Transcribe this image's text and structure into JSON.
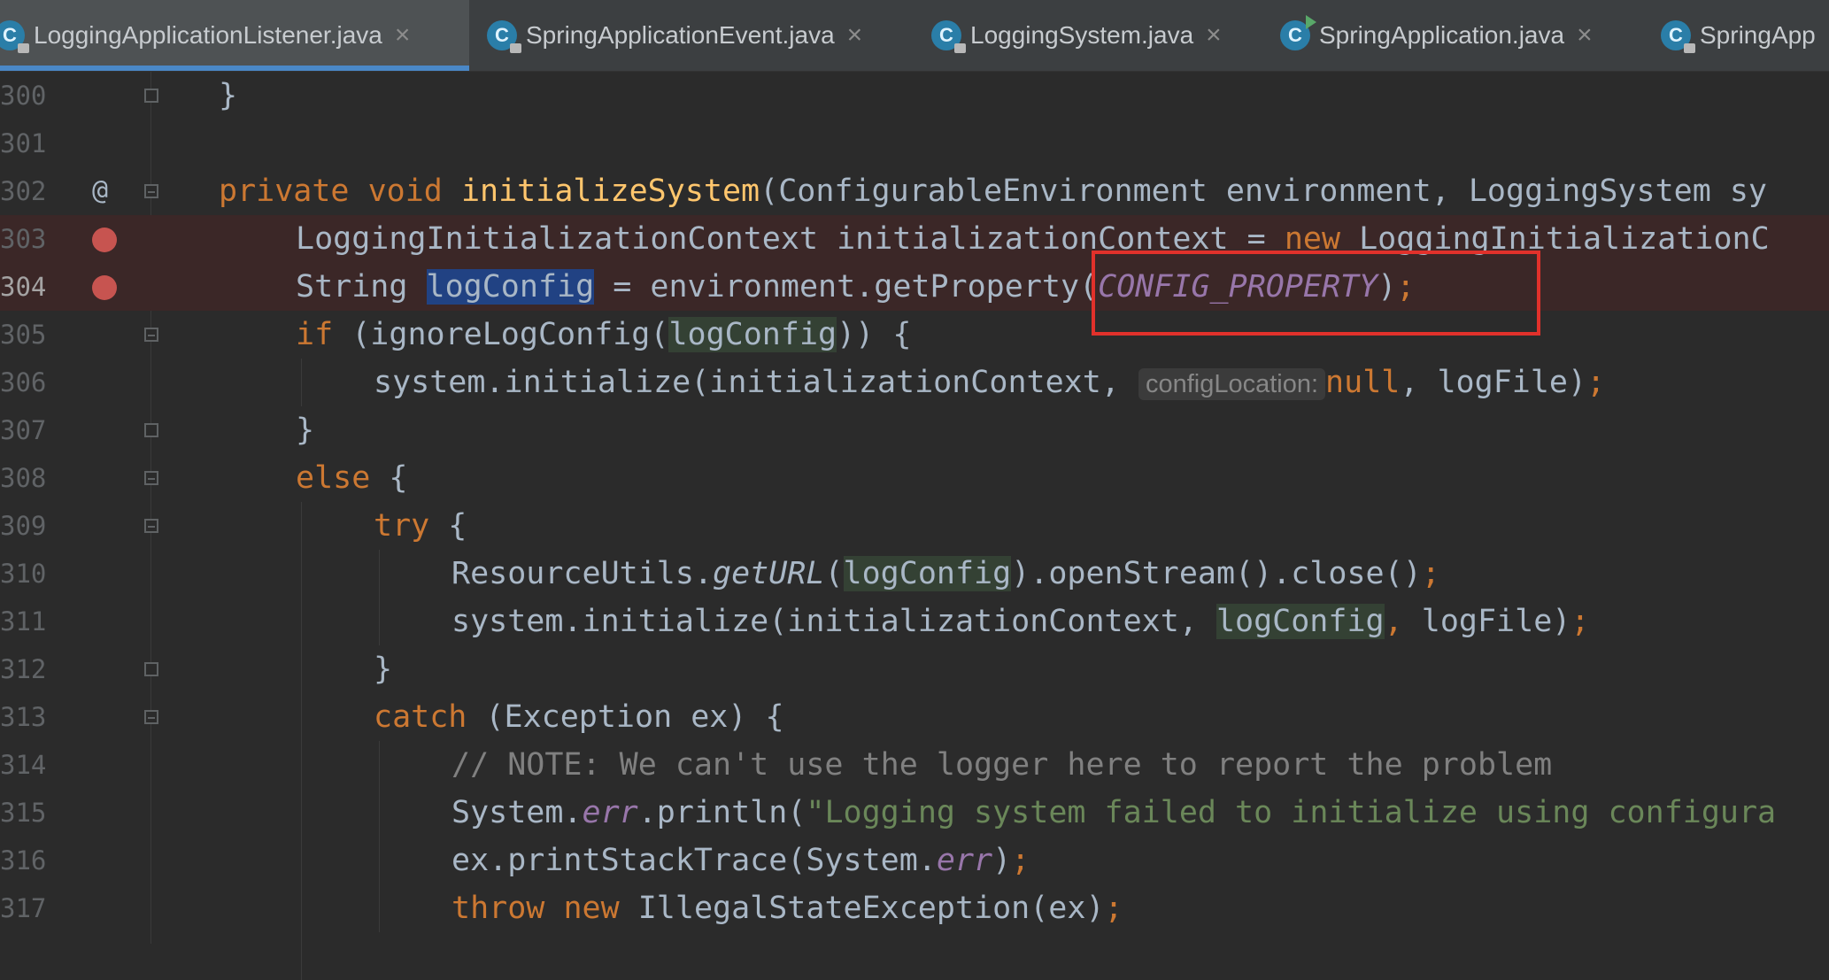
{
  "tabs": [
    {
      "label": "LoggingApplicationListener.java",
      "icon": "C",
      "close": "×",
      "active": true
    },
    {
      "label": "SpringApplicationEvent.java",
      "icon": "C",
      "close": "×"
    },
    {
      "label": "LoggingSystem.java",
      "icon": "C",
      "close": "×"
    },
    {
      "label": "SpringApplication.java",
      "icon": "C",
      "close": "×"
    },
    {
      "label": "SpringApp",
      "icon": "C"
    }
  ],
  "gutter": {
    "line_numbers": [
      "300",
      "301",
      "302",
      "303",
      "304",
      "305",
      "306",
      "307",
      "308",
      "309",
      "310",
      "311",
      "312",
      "313",
      "314",
      "315",
      "316",
      "317"
    ],
    "override_marker": "@"
  },
  "code": {
    "l300": {
      "brace": "}"
    },
    "l302": {
      "kw1": "private",
      "kw2": "void",
      "method": "initializeSystem",
      "paren": "(",
      "params": "ConfigurableEnvironment environment, LoggingSystem sy"
    },
    "l303": {
      "decl": "LoggingInitializationContext initializationContext = ",
      "kw": "new",
      "rest": " LoggingInitializationC"
    },
    "l304": {
      "type": "String ",
      "var": "logConfig",
      "assign": " = environment.getProperty(",
      "const": "CONFIG_PROPERTY",
      "close": ")",
      "semi": ";"
    },
    "l305": {
      "kw": "if",
      "a": " (ignoreLogConfig(",
      "var": "logConfig",
      "b": ")) {"
    },
    "l306": {
      "a": "system.initialize(initializationContext, ",
      "hint": "configLocation:",
      "kw": "null",
      "b": ", logFile)",
      "semi": ";"
    },
    "l307": {
      "brace": "}"
    },
    "l308": {
      "kw": "else",
      "b": " {"
    },
    "l309": {
      "kw": "try",
      "b": " {"
    },
    "l310": {
      "a": "ResourceUtils.",
      "m": "getURL",
      "p": "(",
      "var": "logConfig",
      "b": ").openStream().close()",
      "semi": ";"
    },
    "l311": {
      "a": "system.initialize(initializationContext, ",
      "var": "logConfig",
      "sep": ",",
      "b": " logFile)",
      "semi": ";"
    },
    "l312": {
      "brace": "}"
    },
    "l313": {
      "kw": "catch",
      "b": " (Exception ex) {"
    },
    "l314": {
      "comment": "// NOTE: We can't use the logger here to report the problem"
    },
    "l315": {
      "a": "System.",
      "f": "err",
      "b": ".println(",
      "s": "\"Logging system failed to initialize using configura"
    },
    "l316": {
      "a": "ex.printStackTrace(System.",
      "f": "err",
      "b": ")",
      "semi": ";"
    },
    "l317": {
      "kw1": "throw",
      "kw2": "new",
      "b": " IllegalStateException(ex)",
      "semi": ";"
    }
  },
  "colors": {
    "background": "#2b2b2b",
    "keyword": "#cc7832",
    "method_decl": "#ffc66d",
    "constant": "#9876aa",
    "string": "#6a8759",
    "comment": "#808080",
    "breakpoint": "#c75450",
    "annotation_box": "#e1312b",
    "selection": "#214283"
  }
}
